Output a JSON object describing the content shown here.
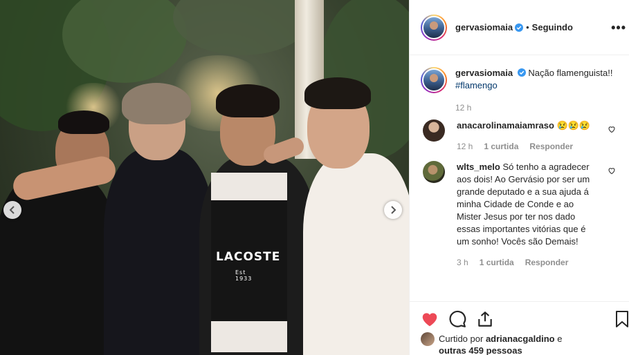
{
  "post": {
    "image_alt": "Foto de quatro homens abraçados",
    "shirt_text": "LACOSTE",
    "shirt_sub": "Est 1933"
  },
  "header": {
    "username": "gervasiomaia",
    "separator": "•",
    "follow_status": "Seguindo",
    "more": "•••"
  },
  "caption": {
    "username": "gervasiomaia",
    "text": "Nação flamenguista!!",
    "hashtag": "#flamengo",
    "time": "12 h"
  },
  "comments": [
    {
      "username": "anacarolinamaiamraso",
      "text": "😢😢😢",
      "time": "12 h",
      "likes": "1 curtida",
      "reply": "Responder"
    },
    {
      "username": "wlts_melo",
      "text": "Só tenho a agradecer aos dois! Ao Gervásio por ser um grande deputado e a sua ajuda á minha Cidade de Conde e ao Mister Jesus por ter nos dado essas importantes vitórias que é um sonho! Vocês são Demais!",
      "time": "3 h",
      "likes": "1 curtida",
      "reply": "Responder"
    }
  ],
  "likes_summary": {
    "prefix": "Curtido por",
    "user": "adrianacgaldino",
    "conj": "e",
    "others": "outras 459 pessoas"
  },
  "colors": {
    "like_red": "#ed4956",
    "verified_blue": "#3897f0",
    "hashtag_blue": "#00376b",
    "muted": "#8e8e8e"
  },
  "icons": [
    "chevron-left-icon",
    "chevron-right-icon",
    "verified-badge-icon",
    "more-options-icon",
    "heart-outline-icon",
    "heart-filled-icon",
    "comment-icon",
    "share-icon",
    "bookmark-icon"
  ]
}
